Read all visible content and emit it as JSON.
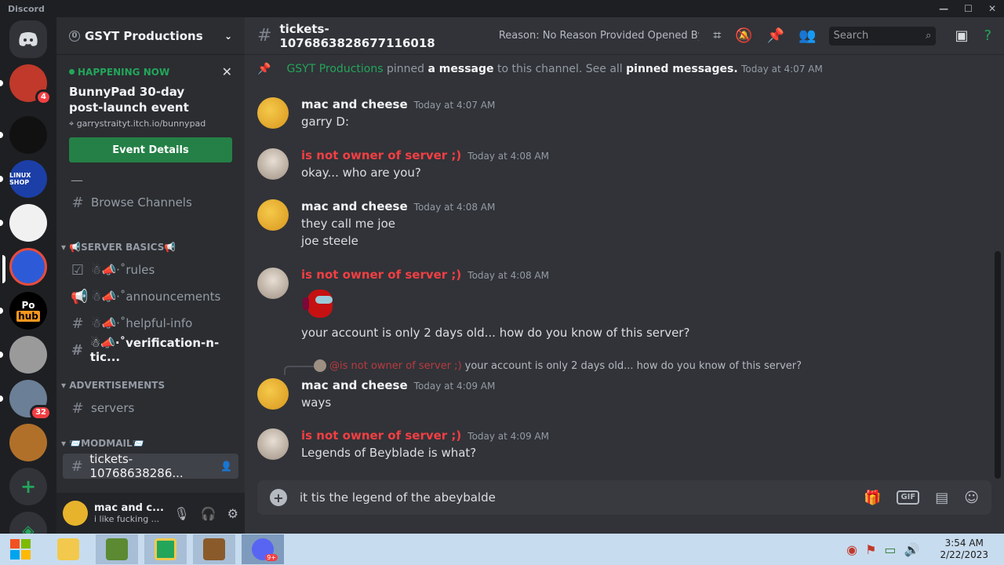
{
  "window": {
    "title": "Discord"
  },
  "server": {
    "name": "GSYT Productions",
    "boost_level": "0"
  },
  "event": {
    "status": "HAPPENING NOW",
    "title": "BunnyPad 30-day post-launch event",
    "location": "garrystraityt.itch.io/bunnypad",
    "button": "Event Details"
  },
  "guild_badges": {
    "g1": "4",
    "g8": "32"
  },
  "guild_labels": {
    "g3": "LINUX SHOP",
    "g6_top": "Po",
    "g6_bottom": "hub"
  },
  "sidebar": {
    "divider": "—",
    "browse": "Browse Channels",
    "category_basics": "📢SERVER BASICS📢",
    "rules": "☃📣·˚rules",
    "announcements": "☃📣·˚announcements",
    "helpful": "☃📣·˚helpful-info",
    "verification": "☃📣·˚verification-n-tic...",
    "category_ads": "ADVERTISEMENTS",
    "servers": "servers",
    "category_modmail": "📨MODMAIL📨",
    "tickets": "tickets-10768638286..."
  },
  "user": {
    "name": "mac and c...",
    "status": "i like fucking ..."
  },
  "channel": {
    "name": "tickets-1076863828677116018",
    "topic": "Reason: No Reason Provided Opened By: m..."
  },
  "search": {
    "placeholder": "Search"
  },
  "pinned": {
    "author": "GSYT Productions",
    "text1": "pinned",
    "link1": "a message",
    "text2": "to this channel. See all",
    "link2": "pinned messages.",
    "time": "Today at 4:07 AM"
  },
  "messages": [
    {
      "author": "mac and cheese",
      "time": "Today at 4:07 AM",
      "lines": [
        "garry D:"
      ]
    },
    {
      "author": "is not owner of server ;)",
      "time": "Today at 4:08 AM",
      "lines": [
        "okay... who are you?"
      ]
    },
    {
      "author": "mac and cheese",
      "time": "Today at 4:08 AM",
      "lines": [
        "they call me joe",
        "joe steele"
      ]
    },
    {
      "author": "is not owner of server ;)",
      "time": "Today at 4:08 AM",
      "lines": [
        "your account is only 2 days old... how do you know of this server?"
      ]
    },
    {
      "author": "mac and cheese",
      "time": "Today at 4:09 AM",
      "lines": [
        "ways"
      ],
      "reply_author": "@is not owner of server ;)",
      "reply_text": "your account is only 2 days old... how do you know of this server?"
    },
    {
      "author": "is not owner of server ;)",
      "time": "Today at 4:09 AM",
      "lines": [
        "Legends of Beyblade is what?"
      ]
    }
  ],
  "composer": {
    "text": "it tis the legend of the abeybalde",
    "gif": "GIF"
  },
  "taskbar": {
    "time": "3:54 AM",
    "date": "2/22/2023",
    "discord_badge": "9+"
  },
  "colors": {
    "red_author": "#f23f43",
    "green_author": "#23a55a",
    "mac_author": "#f2f3f5",
    "accent": "#5865f2"
  }
}
